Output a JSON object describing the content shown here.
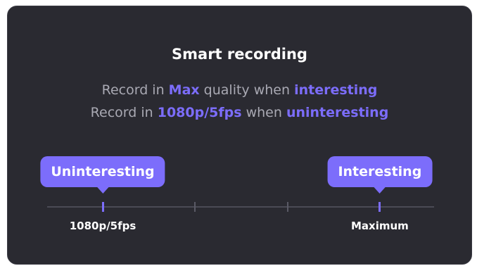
{
  "card": {
    "title": "Smart recording",
    "line1": {
      "prefix": "Record in ",
      "quality": "Max",
      "middle": " quality when ",
      "condition": "interesting"
    },
    "line2": {
      "prefix": "Record in ",
      "quality": "1080p/5fps",
      "middle": " when ",
      "condition": "uninteresting"
    }
  },
  "slider": {
    "stops": 4,
    "uninteresting_stop": 0,
    "interesting_stop": 3,
    "uninteresting_label": "Uninteresting",
    "interesting_label": "Interesting",
    "min_label": "1080p/5fps",
    "max_label": "Maximum"
  },
  "colors": {
    "card_bg": "#2a2a31",
    "accent": "#7c6dfb",
    "muted_text": "#a9a9b3",
    "track": "#4a4a55"
  }
}
